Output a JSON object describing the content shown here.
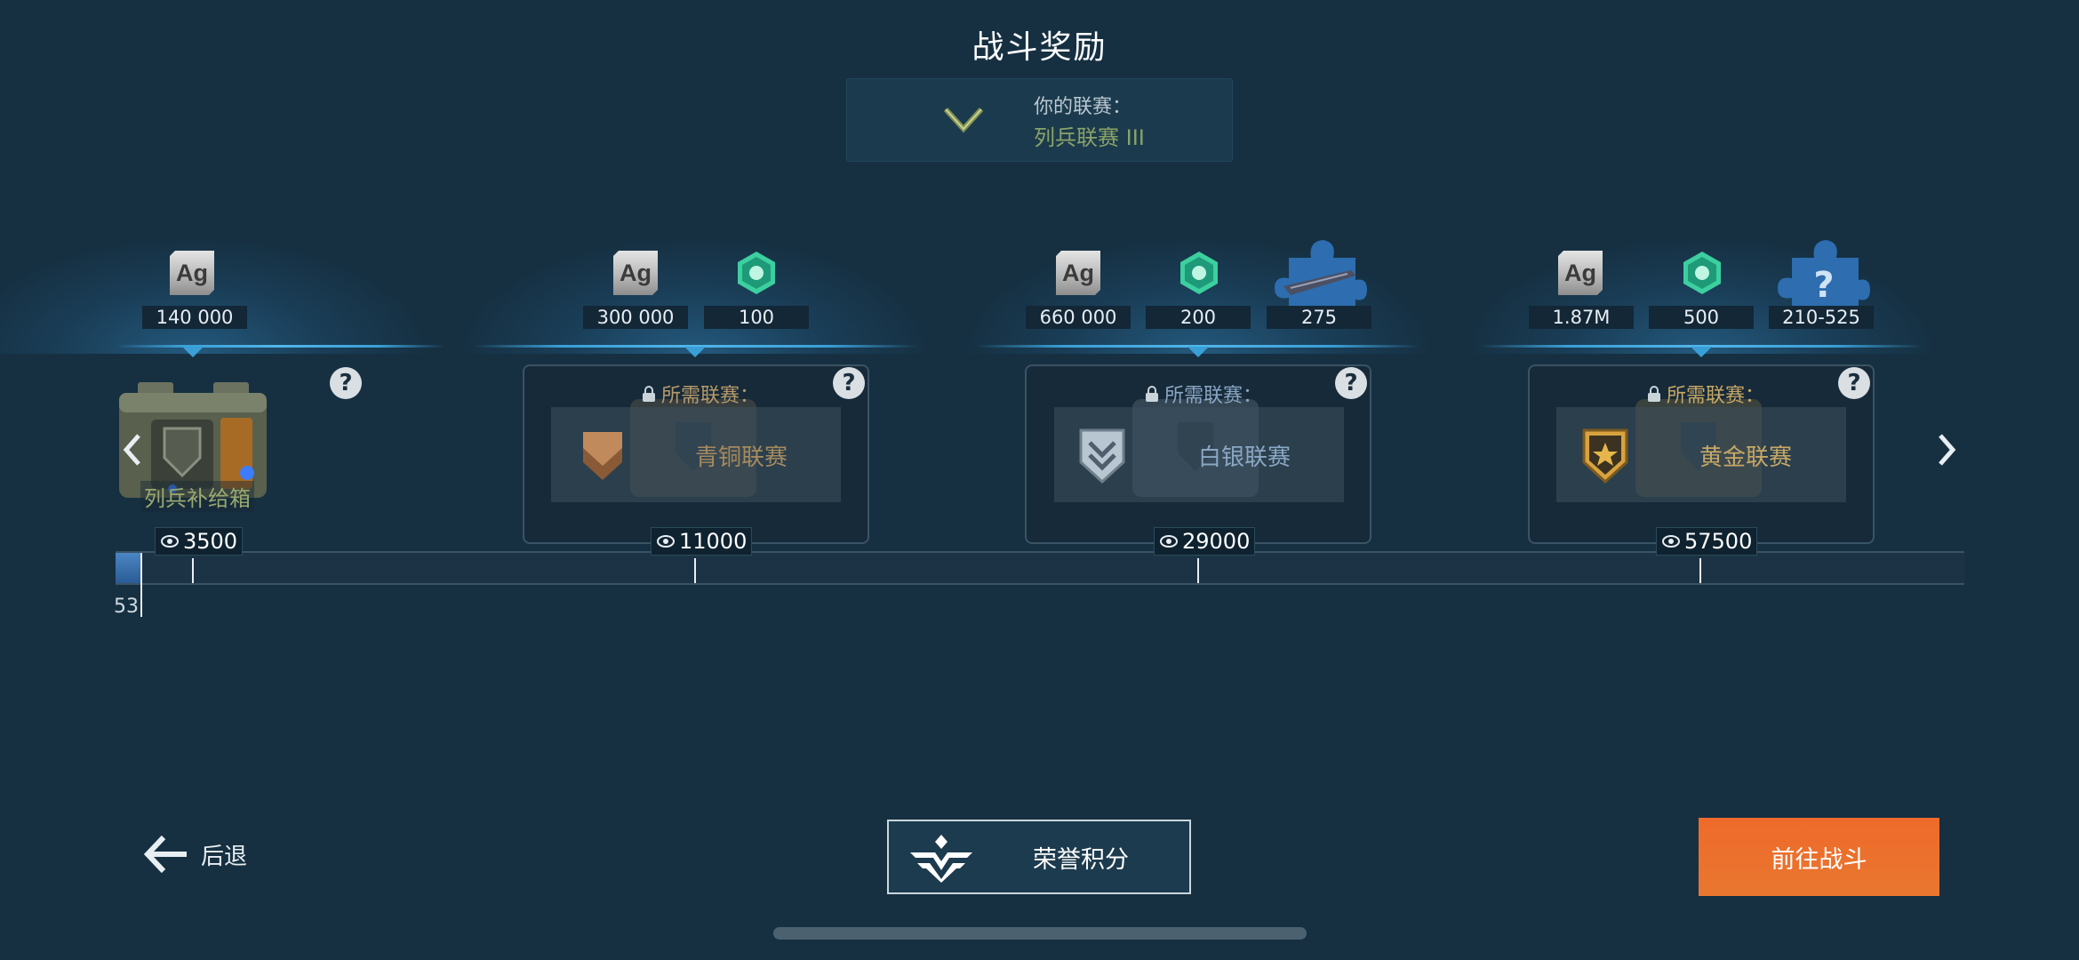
{
  "title": "战斗奖励",
  "league": {
    "label": "你的联赛：",
    "name": "列兵联赛 III"
  },
  "tiers": [
    {
      "rewards": {
        "silver": "140 000"
      },
      "chest_name": "列兵补给箱",
      "threshold": "3500",
      "help": "?"
    },
    {
      "rewards": {
        "silver": "300 000",
        "gems": "100"
      },
      "required_label": "所需联赛：",
      "required_league": "青铜联赛",
      "threshold": "11000",
      "help": "?"
    },
    {
      "rewards": {
        "silver": "660 000",
        "gems": "200",
        "blueprint": "275"
      },
      "required_label": "所需联赛：",
      "required_league": "白银联赛",
      "threshold": "29000",
      "help": "?"
    },
    {
      "rewards": {
        "silver": "1.87M",
        "gems": "500",
        "blueprint": "210-525"
      },
      "required_label": "所需联赛：",
      "required_league": "黄金联赛",
      "threshold": "57500",
      "help": "?"
    }
  ],
  "currency_icon_text": "Ag",
  "current_points": "53",
  "buttons": {
    "back": "后退",
    "honor": "荣誉积分",
    "battle": "前往战斗"
  },
  "colors": {
    "background": "#163042",
    "accent_blue": "#3a9fd6",
    "battle_button": "#ef6a2b",
    "league_name": "#8aa368"
  }
}
